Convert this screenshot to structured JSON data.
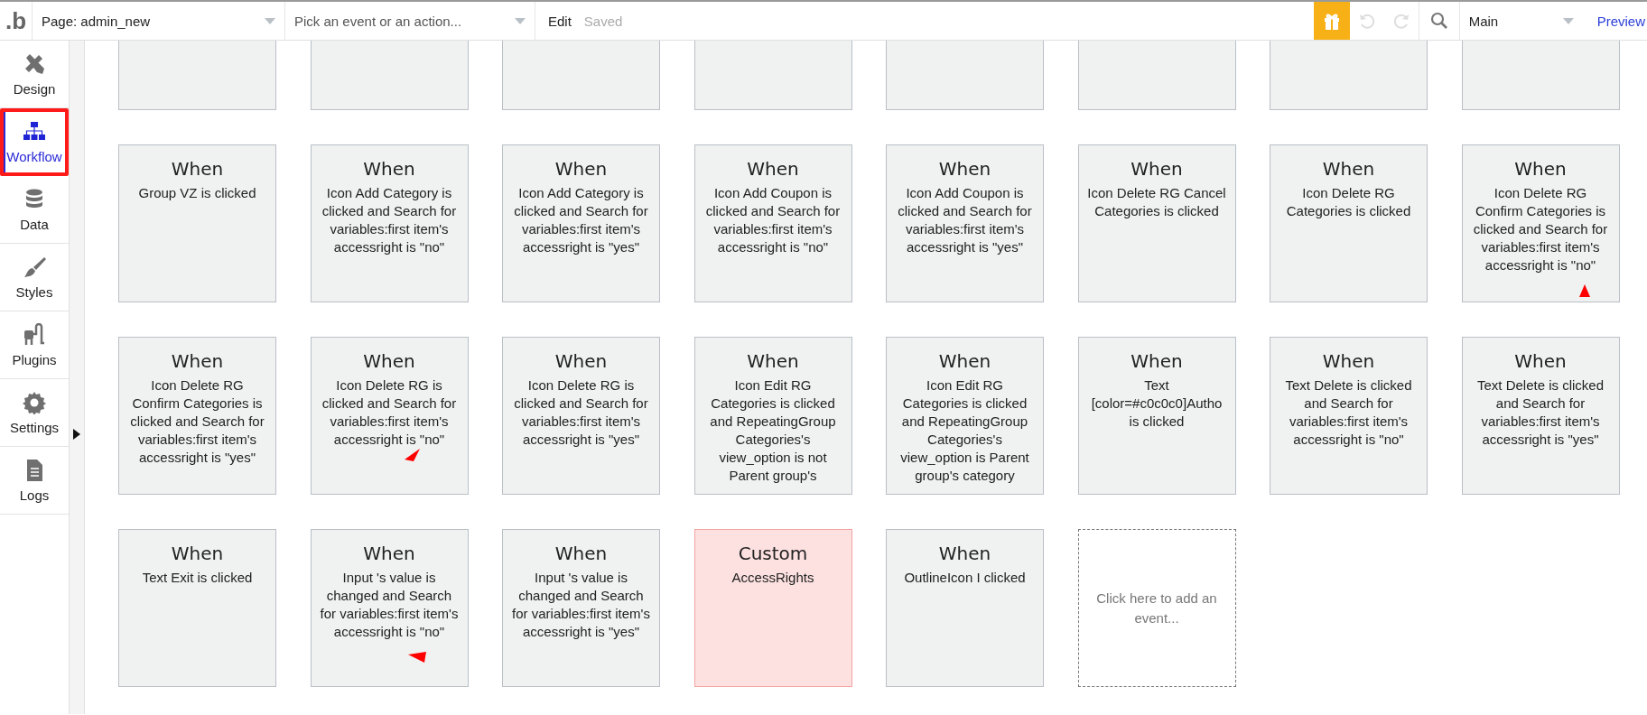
{
  "topbar": {
    "logo": ".b",
    "page_selector": "Page: admin_new",
    "event_selector": {
      "placeholder": "Pick an event or an action..."
    },
    "edit": "Edit",
    "save_status": "Saved",
    "view_selector": "Main",
    "preview": "Preview"
  },
  "sidebar": {
    "items": [
      {
        "label": "Design",
        "selected": false
      },
      {
        "label": "Workflow",
        "selected": true
      },
      {
        "label": "Data",
        "selected": false
      },
      {
        "label": "Styles",
        "selected": false
      },
      {
        "label": "Plugins",
        "selected": false
      },
      {
        "label": "Settings",
        "selected": false
      },
      {
        "label": "Logs",
        "selected": false
      }
    ]
  },
  "events": [
    {
      "kind": "clipped"
    },
    {
      "kind": "clipped"
    },
    {
      "kind": "clipped"
    },
    {
      "kind": "clipped"
    },
    {
      "kind": "clipped"
    },
    {
      "kind": "clipped"
    },
    {
      "kind": "clipped"
    },
    {
      "kind": "clipped"
    },
    {
      "kind": "when",
      "title": "When",
      "text": "Group VZ is clicked"
    },
    {
      "kind": "when",
      "title": "When",
      "text": "Icon Add Category is clicked and Search for variables:first item's accessright is \"no\""
    },
    {
      "kind": "when",
      "title": "When",
      "text": "Icon Add Category is clicked and Search for variables:first item's accessright is \"yes\""
    },
    {
      "kind": "when",
      "title": "When",
      "text": "Icon Add Coupon is clicked and Search for variables:first item's accessright is \"no\""
    },
    {
      "kind": "when",
      "title": "When",
      "text": "Icon Add Coupon is clicked and Search for variables:first item's accessright is \"yes\""
    },
    {
      "kind": "when",
      "title": "When",
      "text": "Icon Delete RG Cancel Categories is clicked"
    },
    {
      "kind": "when",
      "title": "When",
      "text": "Icon Delete RG Categories is clicked"
    },
    {
      "kind": "when",
      "title": "When",
      "text": "Icon Delete RG Confirm Categories is clicked and Search for variables:first item's accessright is \"no\"",
      "pointer": {
        "kind": "up"
      }
    },
    {
      "kind": "when",
      "title": "When",
      "text": "Icon Delete RG Confirm Categories is clicked and Search for variables:first item's accessright is \"yes\""
    },
    {
      "kind": "when",
      "title": "When",
      "text": "Icon Delete RG is clicked and Search for variables:first item's accessright is \"no\"",
      "pointer": {
        "kind": "down-left"
      }
    },
    {
      "kind": "when",
      "title": "When",
      "text": "Icon Delete RG is clicked and Search for variables:first item's accessright is \"yes\""
    },
    {
      "kind": "when",
      "title": "When",
      "text": "Icon Edit RG Categories is clicked and RepeatingGroup Categories's view_option is not Parent group's"
    },
    {
      "kind": "when",
      "title": "When",
      "text": "Icon Edit RG Categories is clicked and RepeatingGroup Categories's view_option is Parent group's category"
    },
    {
      "kind": "when",
      "title": "When",
      "text": "Text [color=#c0c0c0]Autho is clicked"
    },
    {
      "kind": "when",
      "title": "When",
      "text": "Text Delete is clicked and Search for variables:first item's accessright is \"no\""
    },
    {
      "kind": "when",
      "title": "When",
      "text": "Text Delete is clicked and Search for variables:first item's accessright is \"yes\""
    },
    {
      "kind": "when",
      "title": "When",
      "text": "Text Exit is clicked"
    },
    {
      "kind": "when",
      "title": "When",
      "text": "Input 's value is changed and Search for variables:first item's accessright is \"no\"",
      "pointer": {
        "kind": "left"
      }
    },
    {
      "kind": "when",
      "title": "When",
      "text": "Input 's value is changed and Search for variables:first item's accessright is \"yes\""
    },
    {
      "kind": "custom",
      "title": "Custom",
      "text": "AccessRights"
    },
    {
      "kind": "when",
      "title": "When",
      "text": "OutlineIcon I clicked"
    },
    {
      "kind": "add",
      "text": "Click here to add an event..."
    }
  ]
}
